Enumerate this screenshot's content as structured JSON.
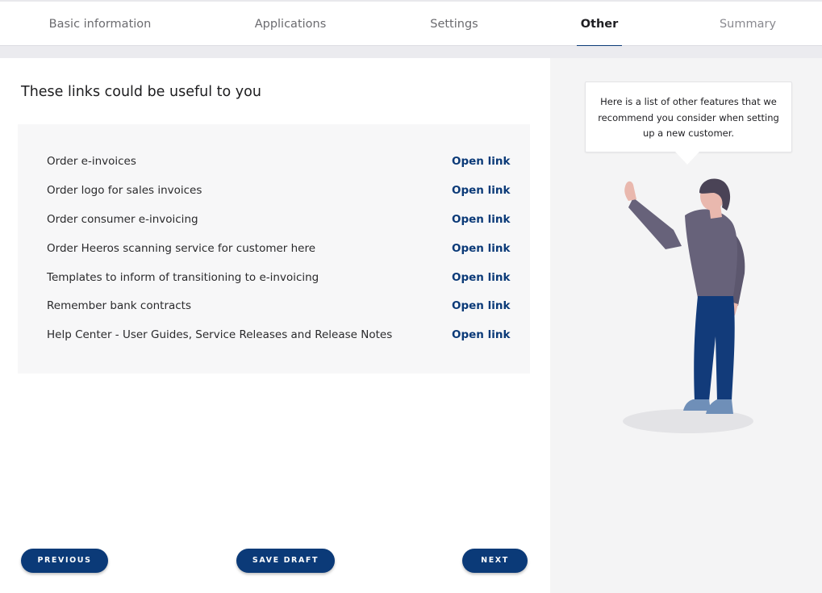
{
  "tabs": [
    {
      "label": "Basic information"
    },
    {
      "label": "Applications"
    },
    {
      "label": "Settings"
    },
    {
      "label": "Other"
    },
    {
      "label": "Summary"
    }
  ],
  "main": {
    "heading": "These links could be useful to you",
    "open_label": "Open link",
    "links": [
      {
        "label": "Order e-invoices"
      },
      {
        "label": "Order logo for sales invoices"
      },
      {
        "label": "Order consumer e-invoicing"
      },
      {
        "label": "Order Heeros scanning service for customer here"
      },
      {
        "label": "Templates to inform of transitioning to e-invoicing"
      },
      {
        "label": "Remember bank contracts"
      },
      {
        "label": "Help Center - User Guides, Service Releases and Release Notes"
      }
    ]
  },
  "buttons": {
    "previous": "PREVIOUS",
    "save_draft": "SAVE DRAFT",
    "next": "NEXT"
  },
  "aside": {
    "tooltip": "Here is a list of other features that we recommend you consider when setting up a new customer."
  },
  "colors": {
    "accent": "#0b3a78",
    "panel": "#f4f4f5"
  }
}
